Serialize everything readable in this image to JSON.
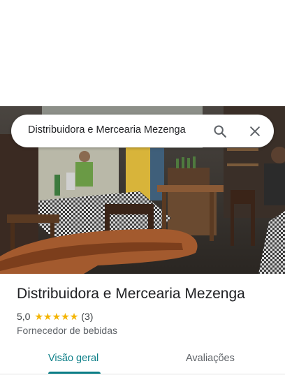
{
  "search": {
    "query": "Distribuidora e Mercearia Mezenga"
  },
  "place": {
    "name": "Distribuidora e Mercearia Mezenga",
    "rating": "5,0",
    "stars": [
      "★",
      "★",
      "★",
      "★",
      "★"
    ],
    "review_count": "(3)",
    "category": "Fornecedor de bebidas"
  },
  "tabs": [
    {
      "label": "Visão geral",
      "selected": true
    },
    {
      "label": "Avaliações",
      "selected": false
    }
  ],
  "colors": {
    "accent": "#0b7e87",
    "star": "#f4b400"
  }
}
